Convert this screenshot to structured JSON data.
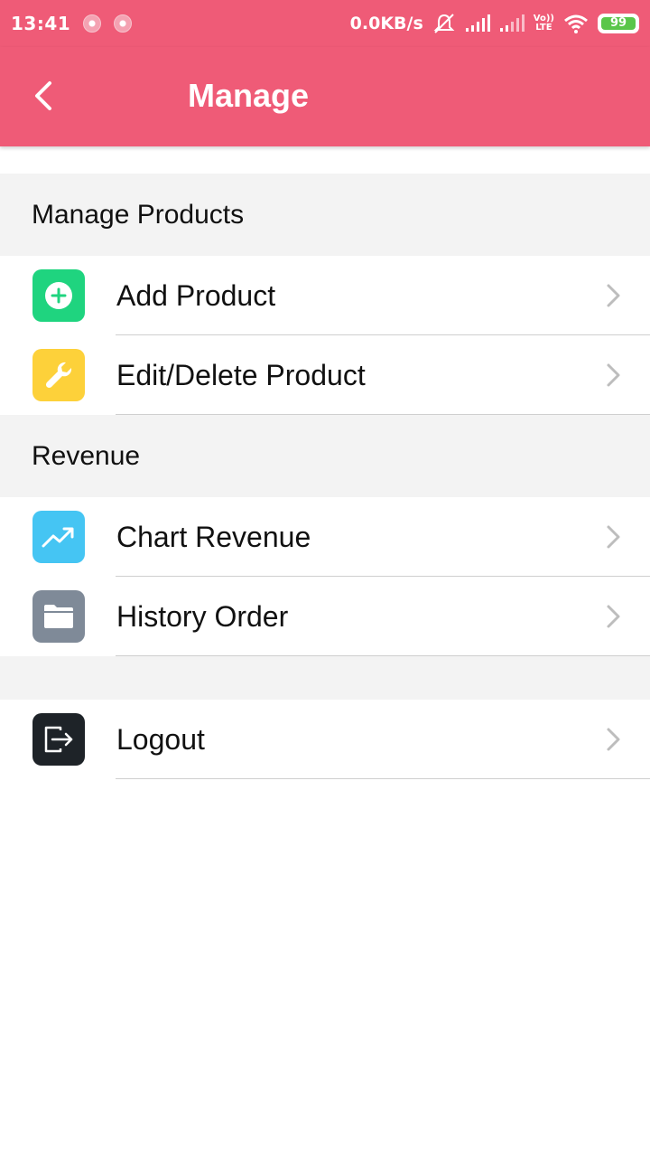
{
  "status_bar": {
    "time": "13:41",
    "network_speed": "0.0KB/s",
    "lte_top": "Vo))",
    "lte_bottom": "LTE",
    "battery": "99"
  },
  "app_bar": {
    "title": "Manage",
    "back_icon": "chevron-left-icon"
  },
  "sections": [
    {
      "header": "Manage Products",
      "items": [
        {
          "label": "Add Product",
          "icon": "add-circle-icon",
          "color": "#1fd47f"
        },
        {
          "label": "Edit/Delete Product",
          "icon": "wrench-icon",
          "color": "#fdd13a"
        }
      ]
    },
    {
      "header": "Revenue",
      "items": [
        {
          "label": "Chart Revenue",
          "icon": "trending-up-icon",
          "color": "#45c5f3"
        },
        {
          "label": "History Order",
          "icon": "folder-icon",
          "color": "#7f8a98"
        }
      ]
    },
    {
      "header": "",
      "items": [
        {
          "label": "Logout",
          "icon": "logout-icon",
          "color": "#1e2328"
        }
      ]
    }
  ],
  "colors": {
    "primary": "#ef5b77",
    "section_bg": "#f3f3f3",
    "chevron": "#bdbdbd"
  }
}
